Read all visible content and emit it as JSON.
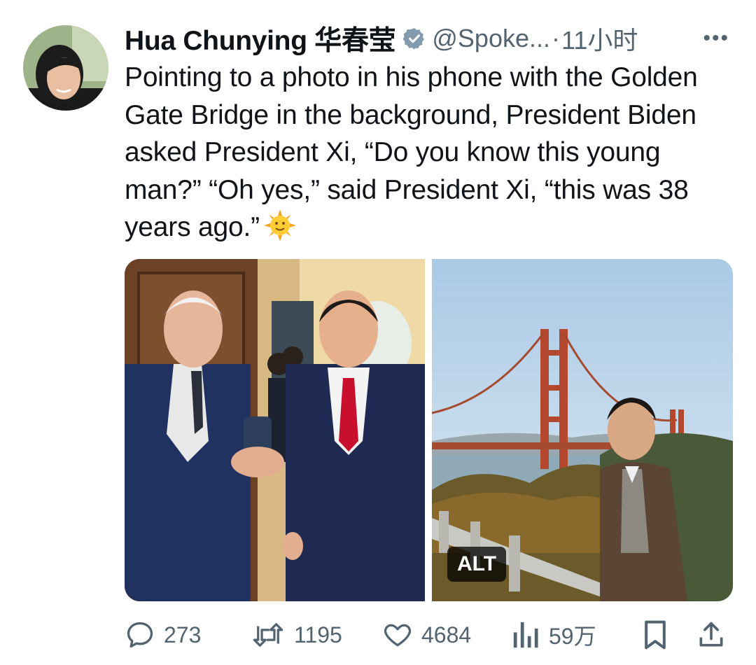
{
  "tweet": {
    "author_name": "Hua Chunying 华春莹",
    "handle": "@Spoke...",
    "separator": "·",
    "time": "11小时",
    "more_label": "•••",
    "text": "Pointing to a photo in his phone with the Golden Gate Bridge in the background, President Biden asked President Xi, “Do you know this young man?” “Oh yes,” said President Xi, “this was 38 years ago.”",
    "emoji": "sun-with-face-icon",
    "media": {
      "alt_badge": "ALT"
    }
  },
  "actions": {
    "replies": "273",
    "retweets": "1195",
    "likes": "4684",
    "views": "59万"
  },
  "colors": {
    "text": "#0f1419",
    "secondary": "#536471",
    "verified_badge": "#829aab"
  }
}
